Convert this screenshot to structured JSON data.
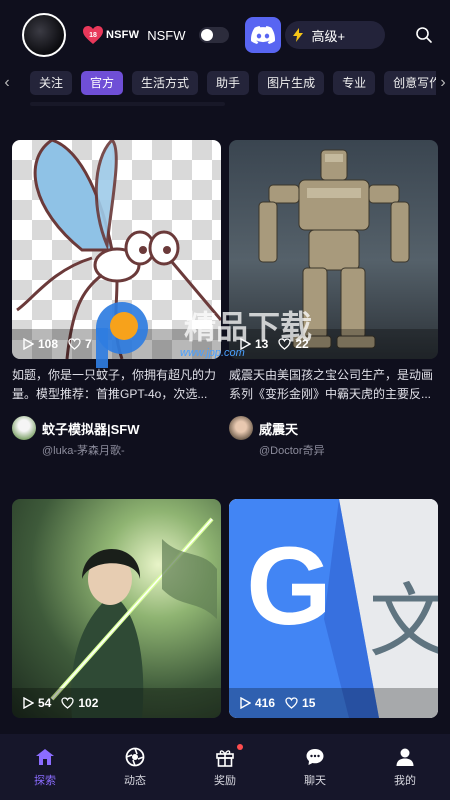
{
  "header": {
    "nsfw_logo_badge": "18",
    "nsfw_logo_text": "NSFW",
    "nsfw_label": "NSFW",
    "nsfw_toggle_on": false,
    "upgrade_label": "高级+",
    "icons": [
      "avatar",
      "heart-18-icon",
      "discord-icon",
      "bolt-icon",
      "search-icon"
    ]
  },
  "tabs": [
    {
      "label": "关注",
      "active": false
    },
    {
      "label": "官方",
      "active": true
    },
    {
      "label": "生活方式",
      "active": false
    },
    {
      "label": "助手",
      "active": false
    },
    {
      "label": "图片生成",
      "active": false
    },
    {
      "label": "专业",
      "active": false
    },
    {
      "label": "创意写作",
      "active": false
    }
  ],
  "cards": [
    {
      "views": "108",
      "likes": "7",
      "desc": "如题，你是一只蚊子，你拥有超凡的力量。模型推荐：首推GPT-4o，次选...",
      "name": "蚊子模拟器|SFW",
      "handle": "@luka-茅森月歌-"
    },
    {
      "views": "13",
      "likes": "22",
      "desc": "威震天由美国孩之宝公司生产，是动画系列《变形金刚》中霸天虎的主要反...",
      "name": "威震天",
      "handle": "@Doctor奇异"
    },
    {
      "views": "54",
      "likes": "102",
      "desc": "",
      "name": "",
      "handle": ""
    },
    {
      "views": "416",
      "likes": "15",
      "desc": "",
      "name": "",
      "handle": ""
    }
  ],
  "watermark": {
    "title": "精品下载",
    "url": "www.jpp.com"
  },
  "nav": [
    {
      "label": "探索",
      "icon": "home-icon",
      "active": true
    },
    {
      "label": "动态",
      "icon": "aperture-icon",
      "active": false
    },
    {
      "label": "奖励",
      "icon": "gift-icon",
      "active": false,
      "dot": true
    },
    {
      "label": "聊天",
      "icon": "chat-icon",
      "active": false
    },
    {
      "label": "我的",
      "icon": "user-icon",
      "active": false
    }
  ],
  "colors": {
    "accent": "#6f4fd6",
    "background": "#0f0f1d",
    "nav_active": "#8b6cff",
    "discord": "#5865f2"
  }
}
